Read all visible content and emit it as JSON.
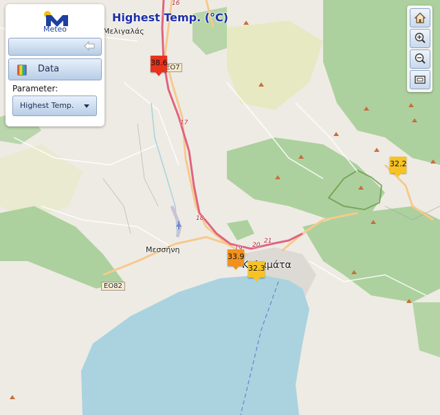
{
  "title": "Highest Temp. (°C)",
  "logo": {
    "text": "Meteo"
  },
  "panel": {
    "data_button": "Data",
    "parameter_label": "Parameter:",
    "parameter_value": "Highest Temp."
  },
  "toolbar": [
    "home-icon",
    "zoom-in-icon",
    "zoom-out-icon",
    "extent-icon"
  ],
  "places": {
    "meligalas": "Μελιγαλάς",
    "messini": "Μεσσήνη",
    "kalamata": "Καλαμάτα"
  },
  "roads": {
    "e082": "ΕΟ82",
    "eo7": "ΕΟ7",
    "n16": "16",
    "n17": "17",
    "n18": "18",
    "n19": "19",
    "n20": "20",
    "n21": "21"
  },
  "markers": [
    {
      "value": "38.6",
      "color": "#e8321e"
    },
    {
      "value": "33.9",
      "color": "#f0921e"
    },
    {
      "value": "32.3",
      "color": "#f6c323"
    },
    {
      "value": "32.2",
      "color": "#f6c323"
    }
  ],
  "colors": {
    "title": "#1d2fa8",
    "sea": "#aad3df",
    "forest": "#add19e",
    "motorway": "#e0637f",
    "primary": "#f7c98b"
  }
}
